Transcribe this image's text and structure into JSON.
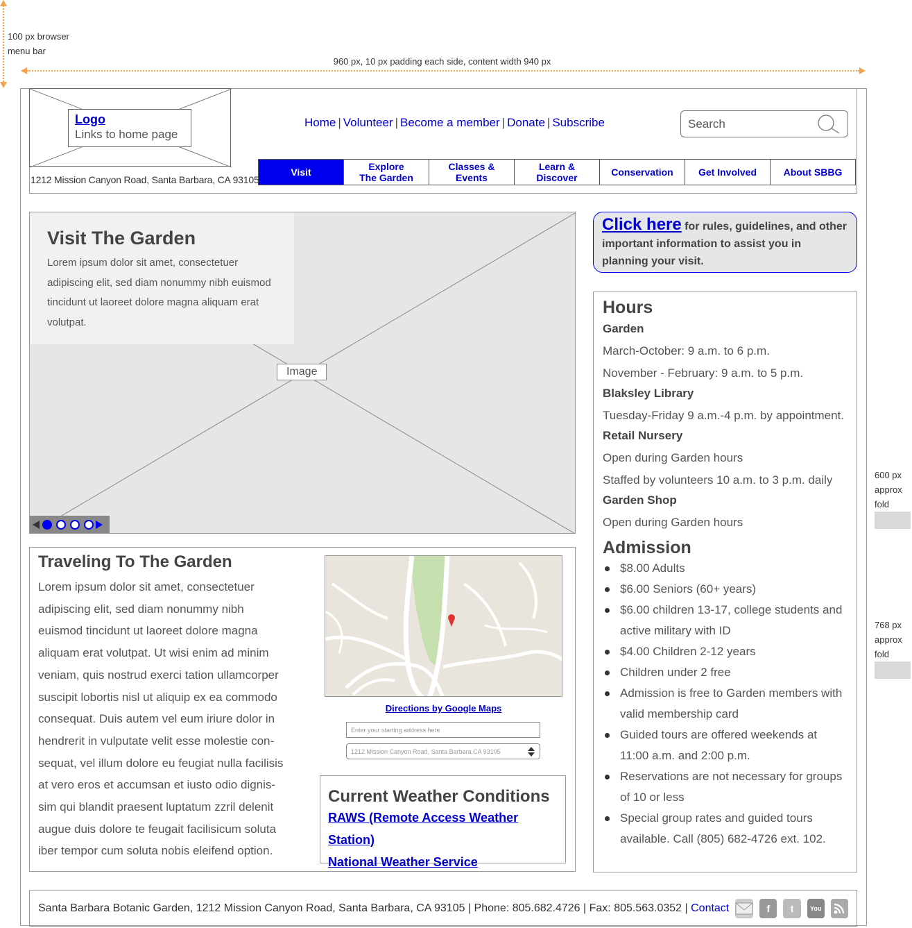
{
  "annotations": {
    "menu_bar": "100 px browser menu bar",
    "menu_bar_line1": "100 px browser",
    "menu_bar_line2": "menu bar",
    "content_width": "960 px, 10 px padding each side, content width 940 px",
    "fold_600": [
      "600 px",
      "approx",
      "fold"
    ],
    "fold_768": [
      "768 px",
      "approx",
      "fold"
    ]
  },
  "header": {
    "logo_link": "Logo",
    "logo_sub": "Links to home page",
    "address": "1212 Mission Canyon Road, Santa Barbara, CA 93105",
    "util_nav": [
      "Home",
      "Volunteer",
      "Become a member",
      "Donate",
      "Subscribe"
    ],
    "search_placeholder": "Search"
  },
  "main_nav": [
    {
      "line1": "Visit",
      "line2": "",
      "active": true
    },
    {
      "line1": "Explore",
      "line2": "The Garden",
      "active": false
    },
    {
      "line1": "Classes &",
      "line2": "Events",
      "active": false
    },
    {
      "line1": "Learn &",
      "line2": "Discover",
      "active": false
    },
    {
      "line1": "Conservation",
      "line2": "",
      "active": false
    },
    {
      "line1": "Get Involved",
      "line2": "",
      "active": false
    },
    {
      "line1": "About SBBG",
      "line2": "",
      "active": false
    }
  ],
  "hero": {
    "title": "Visit The Garden",
    "body": "Lorem ipsum dolor sit amet, consectetuer adipiscing elit, sed diam nonummy nibh euismod tincidunt ut laoreet dolore magna aliquam erat volutpat.",
    "image_label": "Image",
    "slides": 4,
    "current_slide": 1
  },
  "callout": {
    "link": "Click here",
    "text": " for rules, guidelines, and other important information to assist you in planning your visit."
  },
  "hours": {
    "title": "Hours",
    "sections": [
      {
        "name": "Garden",
        "lines": [
          "March-October: 9 a.m. to 6 p.m.",
          "November - February: 9 a.m. to 5 p.m."
        ]
      },
      {
        "name": "Blaksley Library",
        "lines": [
          "Tuesday-Friday 9 a.m.-4 p.m. by appointment."
        ]
      },
      {
        "name": "Retail Nursery",
        "lines": [
          "Open during Garden hours",
          "Staffed by volunteers 10 a.m. to 3 p.m. daily"
        ]
      },
      {
        "name": "Garden Shop",
        "lines": [
          "Open during Garden hours"
        ]
      }
    ]
  },
  "admission": {
    "title": "Admission",
    "items": [
      "$8.00 Adults",
      "$6.00 Seniors (60+ years)",
      "$6.00 children 13-17, college students and active military with ID",
      "$4.00 Children 2-12 years",
      "Children under 2 free",
      "Admission is free to Garden members with valid membership card",
      "Guided tours are offered weekends at 11:00 a.m. and 2:00 p.m.",
      "Reservations are not necessary for groups of 10 or less",
      "Special group rates and guided tours available. Call (805) 682-4726 ext. 102."
    ]
  },
  "traveling": {
    "title": "Traveling To The Garden",
    "body": "Lorem ipsum dolor sit amet, consectetuer adipiscing elit, sed diam nonummy nibh euismod tincidunt ut laoreet dolore magna aliquam erat volutpat. Ut wisi enim ad minim veniam, quis nostrud exerci tation ullamcorper suscipit lobortis nisl ut aliquip ex ea commodo consequat. Duis autem vel eum iriure dolor in hendrerit in vulputate velit esse molestie con-sequat, vel illum dolore eu feugiat nulla facilisis at vero eros et accumsan et iusto odio dignis-sim qui blandit praesent luptatum zzril delenit augue duis dolore te feugait facilisicum soluta iber tempor cum soluta nobis eleifend option.",
    "directions_link": "Directions by Google Maps",
    "start_placeholder": "Enter your starting address here",
    "destination": "1212 Mission Canyon Road, Santa Barbara,CA 93105"
  },
  "weather": {
    "title": "Current Weather Conditions",
    "links": [
      "RAWS (Remote Access Weather Station)",
      "National Weather Service"
    ]
  },
  "footer": {
    "text": "Santa Barbara Botanic Garden, 1212 Mission Canyon Road, Santa Barbara, CA 93105 | Phone: 805.682.4726 | Fax: 805.563.0352 | ",
    "contact": "Contact",
    "social": [
      "email-icon",
      "facebook-icon",
      "twitter-icon",
      "youtube-icon",
      "rss-icon"
    ]
  },
  "colors": {
    "link": "#0000cc",
    "active_nav": "#0000ee",
    "annotation": "#f5a04a",
    "placeholder": "#e5e6e8"
  }
}
